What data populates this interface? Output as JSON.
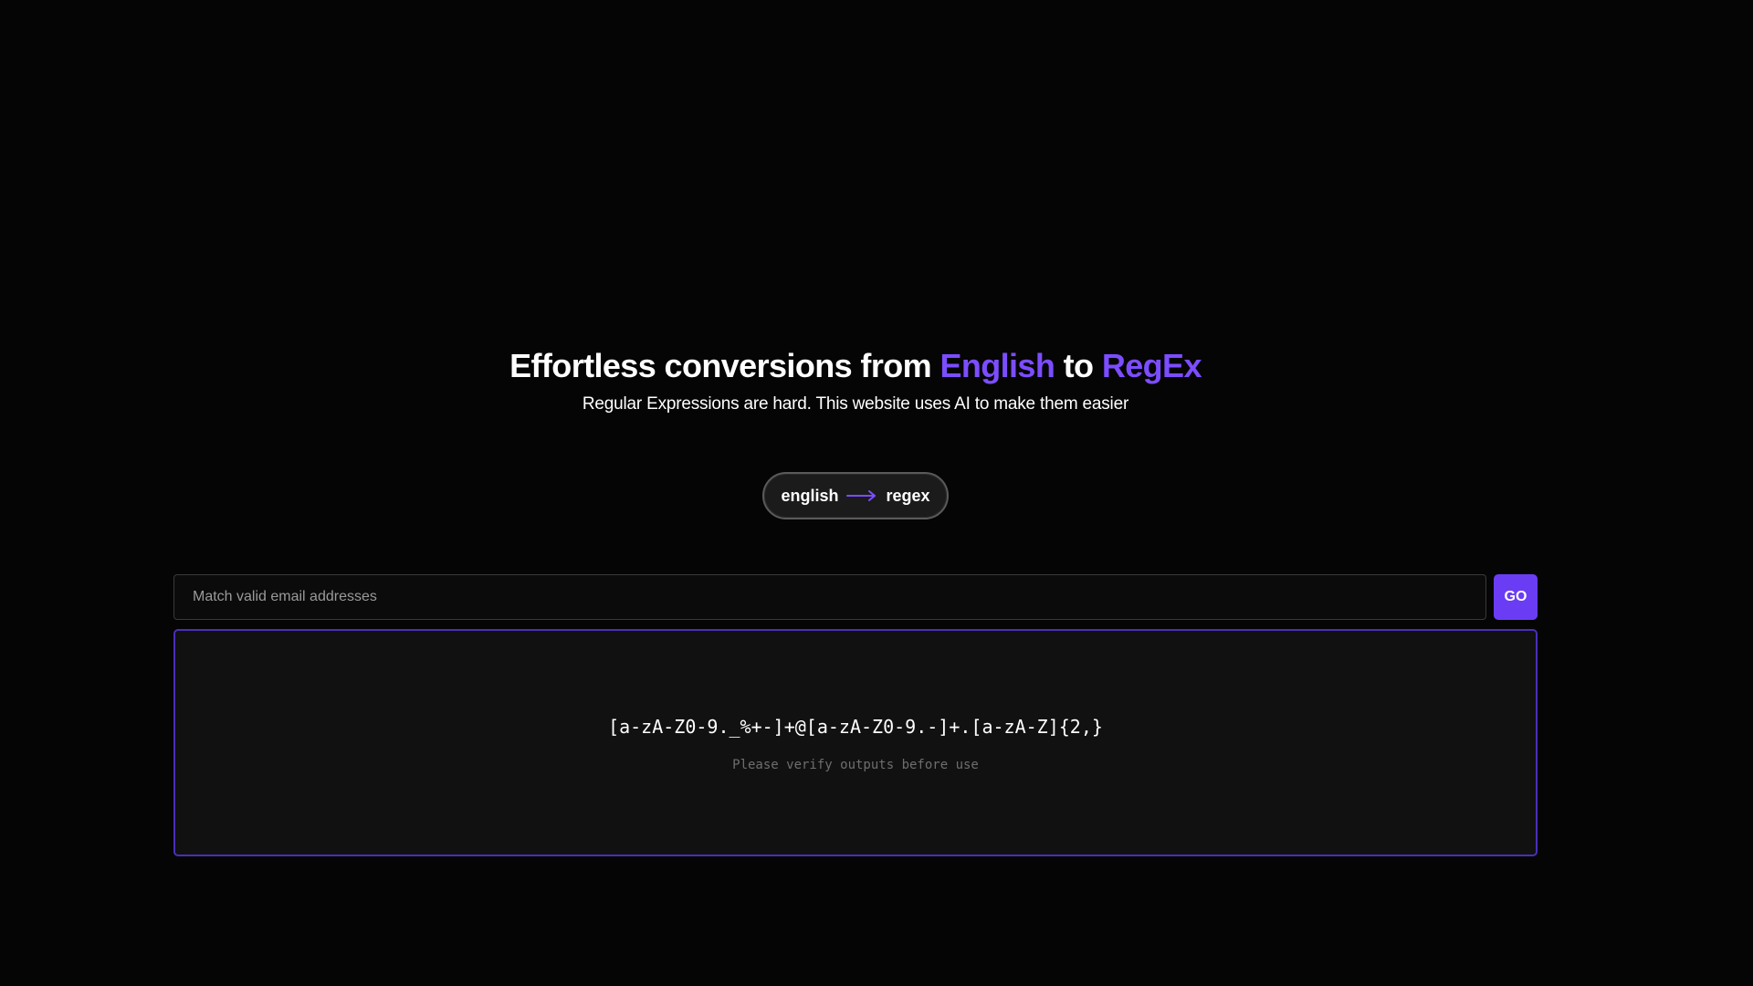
{
  "hero": {
    "title_part1": "Effortless conversions from ",
    "title_accent1": "English",
    "title_part2": " to ",
    "title_accent2": "RegEx",
    "subtitle": "Regular Expressions are hard. This website uses AI to make them easier"
  },
  "mode_toggle": {
    "from_label": "english",
    "to_label": "regex",
    "icon": "arrow-right-icon"
  },
  "query": {
    "placeholder": "Match valid email addresses",
    "value": ""
  },
  "go_button": {
    "label": "GO"
  },
  "output": {
    "regex": "[a-zA-Z0-9._%+-]+@[a-zA-Z0-9.-]+.[a-zA-Z]{2,}",
    "disclaimer": "Please verify outputs before use"
  },
  "colors": {
    "accent": "#7c4dff",
    "button": "#6a3df5",
    "panel_border": "#4a2fb8",
    "background": "#050505"
  }
}
